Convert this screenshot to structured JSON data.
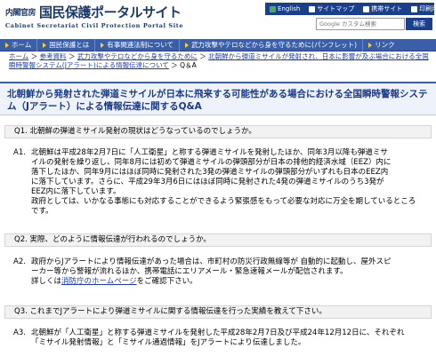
{
  "header": {
    "logo_kantei": "内閣官房",
    "logo_main": "国民保護ポータルサイト",
    "logo_sub": "Cabinet Secretariat Civil Protection Portal Site",
    "top_links": [
      {
        "label": "English"
      },
      {
        "label": "サイトマップ"
      },
      {
        "label": "携帯サイト"
      },
      {
        "label": "印刷用PDF"
      }
    ],
    "search_placeholder": "Google カスタム検索",
    "search_button": "検索"
  },
  "global_nav": [
    {
      "label": "ホーム"
    },
    {
      "label": "国民保護とは"
    },
    {
      "label": "有事関連法制について"
    },
    {
      "label": "武力攻撃やテロなどから身を守るために(パンフレット)"
    },
    {
      "label": "リンク"
    }
  ],
  "breadcrumb": {
    "items": [
      {
        "label": "ホーム"
      },
      {
        "label": "参考資料"
      },
      {
        "label": "武力攻撃やテロなどから身を守るために"
      },
      {
        "label": "北朝鮮から弾道ミサイルが発射され、日本に影響が及ぶ場合における全国瞬時警報システム(Jアラート)による情報伝達について"
      }
    ],
    "current": "Q＆A",
    "separator": "＞"
  },
  "page_title": "北朝鮮から発射された弾道ミサイルが日本に飛来する可能性がある場合における全国瞬時警報システム（Jアラート）による情報伝達に関するQ&A",
  "qa": [
    {
      "q_label": "Q1.",
      "question": "北朝鮮の弾道ミサイル発射の現状はどうなっているのでしょうか。",
      "a_label": "A1.",
      "answer_lines": [
        "北朝鮮は平成28年2月7日に「人工衛星」と称する弾道ミサイルを発射したほか、同年3月以降も弾道ミサ",
        "イルの発射を繰り返し、同年8月には初めて弾道ミサイルの弾頭部分が日本の排他的経済水域（EEZ）内に",
        "落下したほか、同年9月にはほぼ同時に発射された3発の弾道ミサイルの弾頭部分がいずれも日本のEEZ内",
        "に落下しています。さらに、平成29年3月6日にはほぼ同時に発射された4発の弾道ミサイルのうち3発が",
        "EEZ内に落下しています。",
        "政府としては、いかなる事態にも対応することができるよう緊張感をもって必要な対応に万全を期しているところ",
        "です。"
      ]
    },
    {
      "q_label": "Q2.",
      "question": "実際、どのように情報伝達が行われるのでしょうか。",
      "a_label": "A2.",
      "answer_lines": [
        "政府からJアラートにより情報伝達があった場合は、市町村の防災行政無線等が 自動的に起動し、屋外スピ",
        "ーカー等から警報が流れるほか、携帯電話にエリアメール・緊急速報メールが配信されます。"
      ],
      "answer_link_prefix": "詳しくは",
      "answer_link": "消防庁のホームページ",
      "answer_link_suffix": "をご確認下さい。"
    },
    {
      "q_label": "Q3.",
      "question": "これまでJアラートにより弾道ミサイルに関する情報伝達を行った実績を教えて下さい。",
      "a_label": "A3.",
      "answer_lines": [
        "北朝鮮が「人工衛星」と称する弾道ミサイルを発射した平成28年2月7日及び平成24年12月12日に、それぞれ",
        "「ミサイル発射情報」と「ミサイル通過情報」をJアラートにより伝達しました。"
      ]
    }
  ],
  "colors": {
    "nav_bg": "#3a5ea8",
    "topnav_bg": "#1b3f8b",
    "title_color": "#1b3a8b",
    "link": "#1a3fb0"
  }
}
